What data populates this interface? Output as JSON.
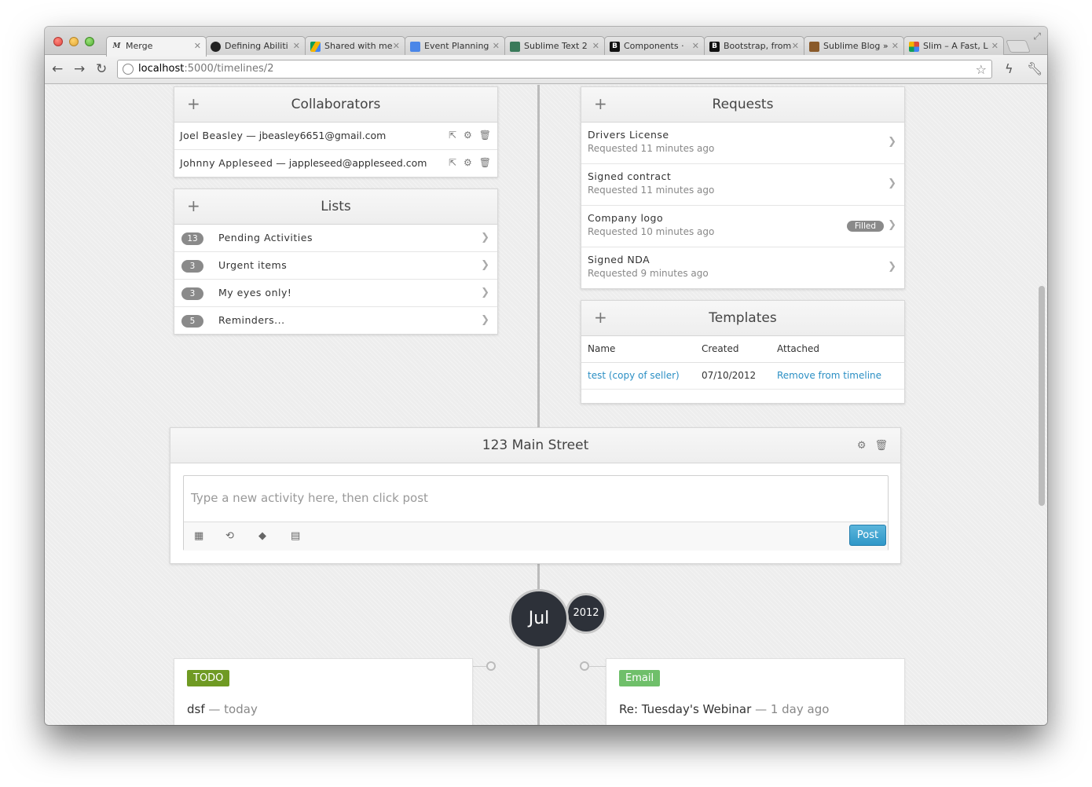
{
  "browser": {
    "tabs": [
      {
        "label": "Merge",
        "favicon": "M",
        "favicon_color": "#ffffff",
        "favicon_text": "#333333",
        "active": true
      },
      {
        "label": "Defining Abiliti",
        "favicon": "gh",
        "favicon_color": "#222222"
      },
      {
        "label": "Shared with me",
        "favicon": "drive",
        "favicon_color": "#f4b400"
      },
      {
        "label": "Event Planning",
        "favicon": "doc",
        "favicon_color": "#4a86e8"
      },
      {
        "label": "Sublime Text 2",
        "favicon": "st",
        "favicon_color": "#3a7a5a"
      },
      {
        "label": "Components ·",
        "favicon": "B",
        "favicon_color": "#111111"
      },
      {
        "label": "Bootstrap, from",
        "favicon": "B",
        "favicon_color": "#111111"
      },
      {
        "label": "Sublime Blog »",
        "favicon": "sb",
        "favicon_color": "#8a5a2a"
      },
      {
        "label": "Slim – A Fast, L",
        "favicon": "g",
        "favicon_color": "#dd4b39"
      }
    ],
    "url_host": "localhost",
    "url_path": ":5000/timelines/2"
  },
  "collaborators": {
    "title": "Collaborators",
    "people": [
      {
        "name": "Joel Beasley",
        "email": "jbeasley6651@gmail.com"
      },
      {
        "name": "Johnny Appleseed",
        "email": "jappleseed@appleseed.com"
      }
    ]
  },
  "lists": {
    "title": "Lists",
    "items": [
      {
        "count": "13",
        "label": "Pending Activities"
      },
      {
        "count": "3",
        "label": "Urgent items"
      },
      {
        "count": "3",
        "label": "My eyes only!"
      },
      {
        "count": "5",
        "label": "Reminders..."
      }
    ]
  },
  "requests": {
    "title": "Requests",
    "items": [
      {
        "title": "Drivers License",
        "sub": "Requested 11 minutes ago",
        "badge": ""
      },
      {
        "title": "Signed contract",
        "sub": "Requested 11 minutes ago",
        "badge": ""
      },
      {
        "title": "Company logo",
        "sub": "Requested 10 minutes ago",
        "badge": "Filled"
      },
      {
        "title": "Signed NDA",
        "sub": "Requested 9 minutes ago",
        "badge": ""
      }
    ]
  },
  "templates": {
    "title": "Templates",
    "columns": [
      "Name",
      "Created",
      "Attached"
    ],
    "rows": [
      {
        "name": "test (copy of seller)",
        "created": "07/10/2012",
        "attached": "Remove from timeline"
      }
    ]
  },
  "composer": {
    "title": "123 Main Street",
    "placeholder": "Type a new activity here, then click post",
    "post_label": "Post"
  },
  "timeline": {
    "month": "Jul",
    "year": "2012",
    "cards": [
      {
        "tag": "TODO",
        "tag_color": "#6f9a23",
        "title": "dsf",
        "when": "— today"
      },
      {
        "tag": "Email",
        "tag_color": "#6fbf6a",
        "title": "Re: Tuesday's Webinar",
        "when": "— 1 day ago"
      }
    ]
  },
  "colors": {
    "accent": "#2b8fc4",
    "badge_gray": "#8a8a8a",
    "timeline_dark": "#2d3139"
  }
}
